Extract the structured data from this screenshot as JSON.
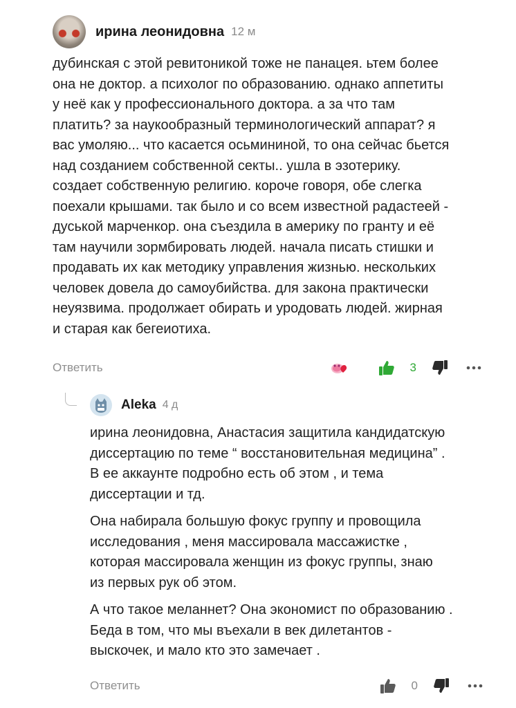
{
  "comment": {
    "author": "ирина леонидовна",
    "time": "12 м",
    "text": "дубинская с этой ревитоникой тоже не панацея. ьтем более\nона не доктор. а психолог по образованию. однако аппетиты\nу неё как у профессионального доктора. а за что там\nплатить? за наукообразный терминологический аппарат? я\nвас умоляю... что касается осьмининой, то она сейчас бьется\nнад созданием собственной секты.. ушла в эзотерику.\nсоздает собственную религию. короче говоря, обе слегка\nпоехали крышами. так было и со всем известной радастеей -\nдуськой марченкор. она съездила в америку по гранту и её\nтам научили зормбировать людей. начала писать стишки и\nпродавать их как методику управления жизнью. нескольких\nчеловек довела до самоубийства. для закона практически\nнеуязвима. продолжает обирать и уродовать людей. жирная\nи старая как бегеиотиха.",
    "reply_label": "Ответить",
    "likes": "3",
    "icons": [
      "reaction-icon",
      "thumb-up-icon",
      "thumb-down-icon",
      "more-icon"
    ],
    "accent_green": "#2fa935"
  },
  "reply": {
    "author": "Aleka",
    "time": "4 д",
    "paragraphs": [
      "ирина леонидовна, Анастасия защитила кандидатскую\nдиссертацию по теме “ восстановительная медицина” .\nВ ее аккаунте подробно есть об этом , и тема\nдиссертации и тд.",
      "Она набирала большую фокус группу и провощила\nисследования , меня массировала массажистке ,\nкоторая массировала женщин из фокус группы, знаю\nиз первых рук об этом.",
      "А что такое меланнет? Она экономист по образованию .\nБеда в том, что мы въехали в век дилетантов -\nвыскочек, и мало кто это замечает ."
    ],
    "reply_label": "Ответить",
    "likes": "0"
  }
}
